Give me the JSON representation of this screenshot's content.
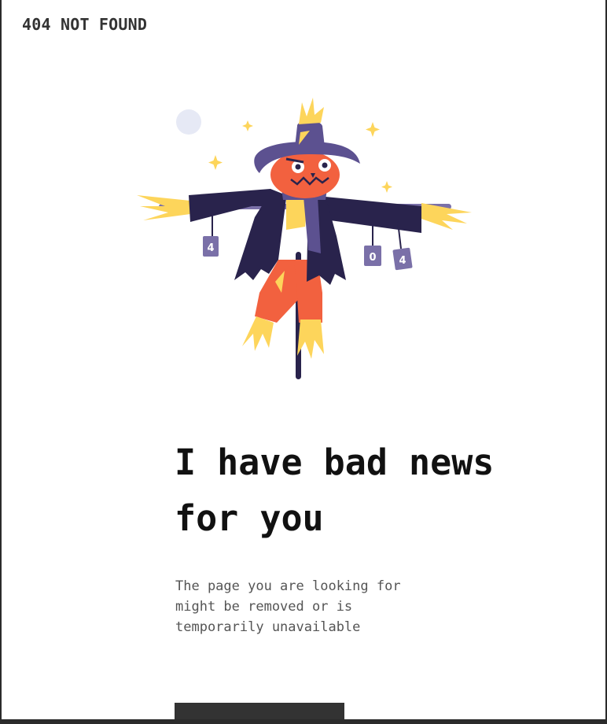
{
  "header": {
    "brand_label": "404 NOT FOUND"
  },
  "illustration": {
    "can_labels": [
      "4",
      "0",
      "4"
    ],
    "colors": {
      "hat": "#5c5190",
      "coat": "#29234c",
      "face": "#f2613f",
      "straw": "#fdd55b",
      "scarf": "#5c5190",
      "moon": "#e6e9f5",
      "sparkle": "#fdd55b"
    }
  },
  "main": {
    "headline": "I have bad news for you",
    "message": "The page you are looking for might be removed or is temporarily unavailable",
    "button_label": ""
  },
  "colors": {
    "text_dark": "#111111",
    "text_muted": "#555555",
    "button_bg": "#333333",
    "page_border": "#2b2b2b"
  }
}
